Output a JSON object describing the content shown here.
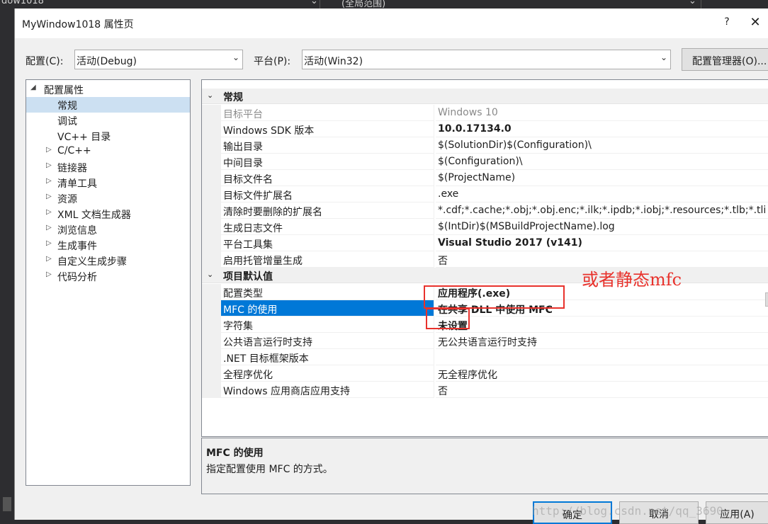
{
  "ide_background": {
    "left_text": "dow1018",
    "right_text": "(全局范围)"
  },
  "dialog": {
    "title": "MyWindow1018 属性页",
    "help": "?",
    "close": "✕"
  },
  "toolbar": {
    "config_label": "配置(C):",
    "config_value": "活动(Debug)",
    "platform_label": "平台(P):",
    "platform_value": "活动(Win32)",
    "config_manager": "配置管理器(O)..."
  },
  "tree": {
    "root": "配置属性",
    "items": [
      {
        "label": "常规",
        "selected": true,
        "expandable": false
      },
      {
        "label": "调试",
        "selected": false,
        "expandable": false
      },
      {
        "label": "VC++ 目录",
        "selected": false,
        "expandable": false
      },
      {
        "label": "C/C++",
        "selected": false,
        "expandable": true
      },
      {
        "label": "链接器",
        "selected": false,
        "expandable": true
      },
      {
        "label": "清单工具",
        "selected": false,
        "expandable": true
      },
      {
        "label": "资源",
        "selected": false,
        "expandable": true
      },
      {
        "label": "XML 文档生成器",
        "selected": false,
        "expandable": true
      },
      {
        "label": "浏览信息",
        "selected": false,
        "expandable": true
      },
      {
        "label": "生成事件",
        "selected": false,
        "expandable": true
      },
      {
        "label": "自定义生成步骤",
        "selected": false,
        "expandable": true
      },
      {
        "label": "代码分析",
        "selected": false,
        "expandable": true
      }
    ]
  },
  "grid": {
    "categories": [
      {
        "name": "常规",
        "rows": [
          {
            "name": "目标平台",
            "value": "Windows 10",
            "dim": true,
            "bold": false
          },
          {
            "name": "Windows SDK 版本",
            "value": "10.0.17134.0",
            "dim": false,
            "bold": true
          },
          {
            "name": "输出目录",
            "value": "$(SolutionDir)$(Configuration)\\",
            "dim": false,
            "bold": false
          },
          {
            "name": "中间目录",
            "value": "$(Configuration)\\",
            "dim": false,
            "bold": false
          },
          {
            "name": "目标文件名",
            "value": "$(ProjectName)",
            "dim": false,
            "bold": false
          },
          {
            "name": "目标文件扩展名",
            "value": ".exe",
            "dim": false,
            "bold": false
          },
          {
            "name": "清除时要删除的扩展名",
            "value": "*.cdf;*.cache;*.obj;*.obj.enc;*.ilk;*.ipdb;*.iobj;*.resources;*.tlb;*.tli",
            "dim": false,
            "bold": false
          },
          {
            "name": "生成日志文件",
            "value": "$(IntDir)$(MSBuildProjectName).log",
            "dim": false,
            "bold": false
          },
          {
            "name": "平台工具集",
            "value": "Visual Studio 2017 (v141)",
            "dim": false,
            "bold": true
          },
          {
            "name": "启用托管增量生成",
            "value": "否",
            "dim": false,
            "bold": false
          }
        ]
      },
      {
        "name": "项目默认值",
        "rows": [
          {
            "name": "配置类型",
            "value": "应用程序(.exe)",
            "dim": false,
            "bold": true
          },
          {
            "name": "MFC 的使用",
            "value": "在共享 DLL 中使用 MFC",
            "dim": false,
            "bold": true,
            "selected": true
          },
          {
            "name": "字符集",
            "value": "未设置",
            "dim": false,
            "bold": true
          },
          {
            "name": "公共语言运行时支持",
            "value": "无公共语言运行时支持",
            "dim": false,
            "bold": false
          },
          {
            "name": ".NET 目标框架版本",
            "value": "",
            "dim": false,
            "bold": false
          },
          {
            "name": "全程序优化",
            "value": "无全程序优化",
            "dim": false,
            "bold": false
          },
          {
            "name": "Windows 应用商店应用支持",
            "value": "否",
            "dim": false,
            "bold": false
          }
        ]
      }
    ]
  },
  "annotation": {
    "text": "或者静态mfc",
    "color": "#e8322c"
  },
  "description": {
    "title": "MFC 的使用",
    "text": "指定配置使用 MFC 的方式。"
  },
  "buttons": {
    "ok": "确定",
    "cancel": "取消",
    "apply": "应用(A)"
  },
  "watermark": "http://blog.csdn.net/qq_3690"
}
